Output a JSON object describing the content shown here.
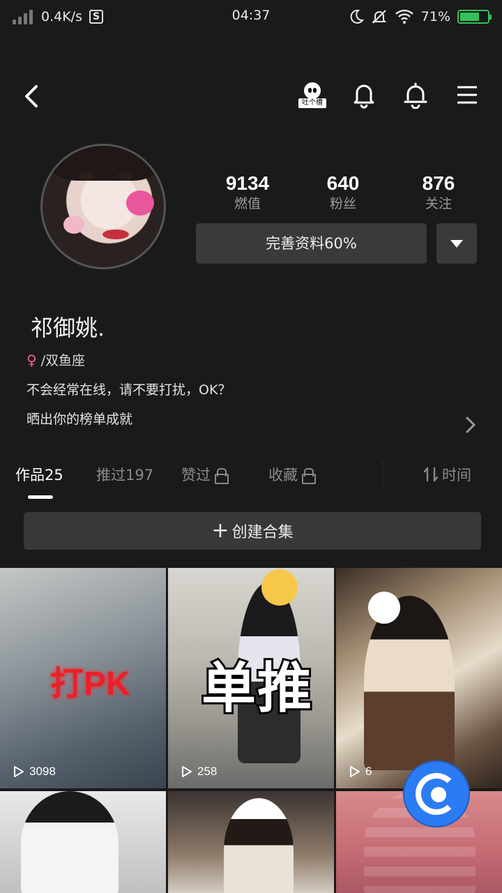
{
  "status_bar": {
    "net_speed": "0.4K/s",
    "s_badge": "S",
    "time": "04:37",
    "battery_pct": "71%",
    "battery_level": 0.71
  },
  "topbar": {
    "qq_label": "吐个槽",
    "icons": [
      "back-icon",
      "qq-icon",
      "ring-bell-icon",
      "bell-icon",
      "menu-icon"
    ]
  },
  "profile": {
    "stats": [
      {
        "num": "9134",
        "label": "燃值"
      },
      {
        "num": "640",
        "label": "粉丝"
      },
      {
        "num": "876",
        "label": "关注"
      }
    ],
    "edit_label": "完善资料60%",
    "name": "祁御姚.",
    "gender_zodiac": "/双鱼座",
    "bio_line1": "不会经常在线，请不要打扰，OK？",
    "bio_line2": "晒出你的榜单成就"
  },
  "tabs": {
    "works": "作品25",
    "recommended": "推过197",
    "liked": "赞过",
    "favorites": "收藏",
    "sort": "时间"
  },
  "create_collection": "创建合集",
  "grid": {
    "items": [
      {
        "plays": "3098",
        "overlay": "打PK"
      },
      {
        "plays": "258",
        "overlay": "单推"
      },
      {
        "plays": "6",
        "overlay": ""
      }
    ]
  },
  "colors": {
    "background": "#1a1a1a",
    "button": "#3a3a3a",
    "battery_green": "#33c35a",
    "fab_blue": "#2b7bf3"
  }
}
